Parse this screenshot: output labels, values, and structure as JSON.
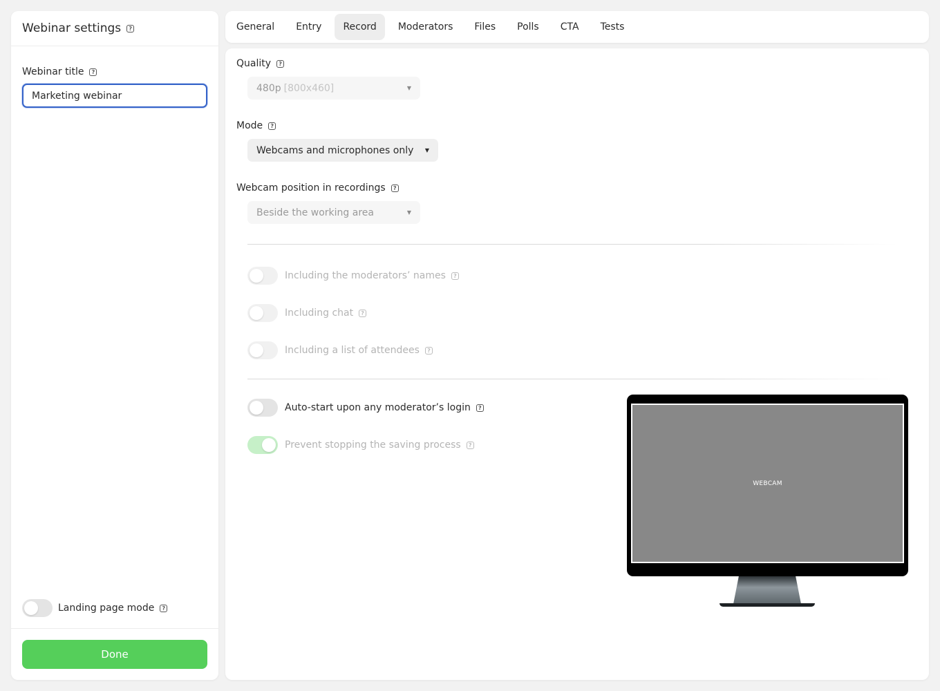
{
  "sidebar": {
    "title": "Webinar settings",
    "webinar_title_label": "Webinar title",
    "webinar_title_value": "Marketing webinar",
    "landing_page_label": "Landing page mode",
    "landing_page_on": false,
    "done_label": "Done"
  },
  "tabs": [
    {
      "label": "General",
      "active": false
    },
    {
      "label": "Entry",
      "active": false
    },
    {
      "label": "Record",
      "active": true
    },
    {
      "label": "Moderators",
      "active": false
    },
    {
      "label": "Files",
      "active": false
    },
    {
      "label": "Polls",
      "active": false
    },
    {
      "label": "CTA",
      "active": false
    },
    {
      "label": "Tests",
      "active": false
    }
  ],
  "record": {
    "quality_label": "Quality",
    "quality_value": "480p",
    "quality_resolution": "[800x460]",
    "mode_label": "Mode",
    "mode_value": "Webcams and microphones only",
    "webcam_position_label": "Webcam position in recordings",
    "webcam_position_value": "Beside the working area",
    "options": [
      {
        "label": "Including the moderators’ names",
        "on": false,
        "disabled": true
      },
      {
        "label": "Including chat",
        "on": false,
        "disabled": true
      },
      {
        "label": "Including a list of attendees",
        "on": false,
        "disabled": true
      }
    ],
    "autostart_label": "Auto-start upon any moderator’s login",
    "autostart_on": false,
    "prevent_stop_label": "Prevent stopping the saving process",
    "prevent_stop_on": true,
    "preview_screen_label": "WEBCAM"
  },
  "icons": {
    "help": "help-icon",
    "caret": "caret-down-icon"
  },
  "colors": {
    "done_button": "#55cf5a",
    "focus_border": "#3563c9",
    "toggle_on_disabled": "#c6f0c8"
  }
}
